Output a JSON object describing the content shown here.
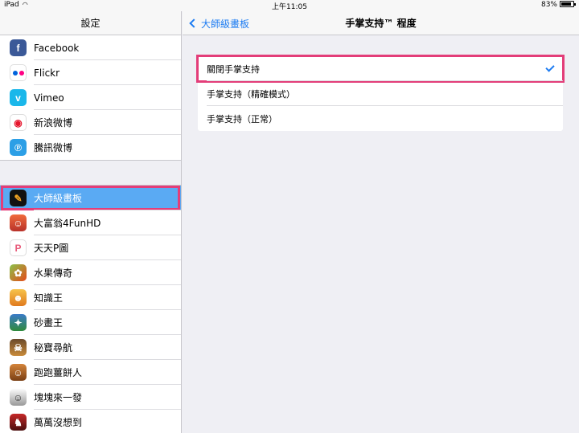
{
  "status_bar": {
    "device": "iPad",
    "time": "上午11:05",
    "battery": "83%"
  },
  "sidebar": {
    "title": "設定",
    "social_items": [
      {
        "label": "Facebook",
        "icon": "facebook-icon",
        "glyph": "f"
      },
      {
        "label": "Flickr",
        "icon": "flickr-icon",
        "glyph": ""
      },
      {
        "label": "Vimeo",
        "icon": "vimeo-icon",
        "glyph": "v"
      },
      {
        "label": "新浪微博",
        "icon": "weibo-icon",
        "glyph": "◉"
      },
      {
        "label": "騰訊微博",
        "icon": "tencent-weibo-icon",
        "glyph": "℗"
      }
    ],
    "app_items": [
      {
        "label": "大師級畫板",
        "icon": "paint-brush-app-icon",
        "glyph": "✎",
        "selected": true
      },
      {
        "label": "大富翁4FunHD",
        "icon": "rich-game-app-icon",
        "glyph": "☺"
      },
      {
        "label": "天天P圖",
        "icon": "ttpic-app-icon",
        "glyph": "P"
      },
      {
        "label": "水果傳奇",
        "icon": "fruit-game-app-icon",
        "glyph": "✿"
      },
      {
        "label": "知識王",
        "icon": "quiz-app-icon",
        "glyph": "☻"
      },
      {
        "label": "砂畫王",
        "icon": "sand-paint-app-icon",
        "glyph": "✦"
      },
      {
        "label": "秘寶尋航",
        "icon": "treasure-app-icon",
        "glyph": "☠"
      },
      {
        "label": "跑跑薑餅人",
        "icon": "cookie-run-app-icon",
        "glyph": "☺"
      },
      {
        "label": "塊塊來一發",
        "icon": "block-game-app-icon",
        "glyph": "☺"
      },
      {
        "label": "萬萬沒想到",
        "icon": "wanwan-app-icon",
        "glyph": "♞"
      }
    ]
  },
  "nav": {
    "back_label": "大師級畫板",
    "title": "手掌支持™ 程度"
  },
  "options": [
    {
      "label": "關閉手掌支持",
      "checked": true
    },
    {
      "label": "手掌支持（精確模式）",
      "checked": false
    },
    {
      "label": "手掌支持（正常）",
      "checked": false
    }
  ],
  "colors": {
    "accent": "#1d7cf2",
    "selection": "#5aaaf3",
    "highlight_frame": "#e33d79"
  }
}
